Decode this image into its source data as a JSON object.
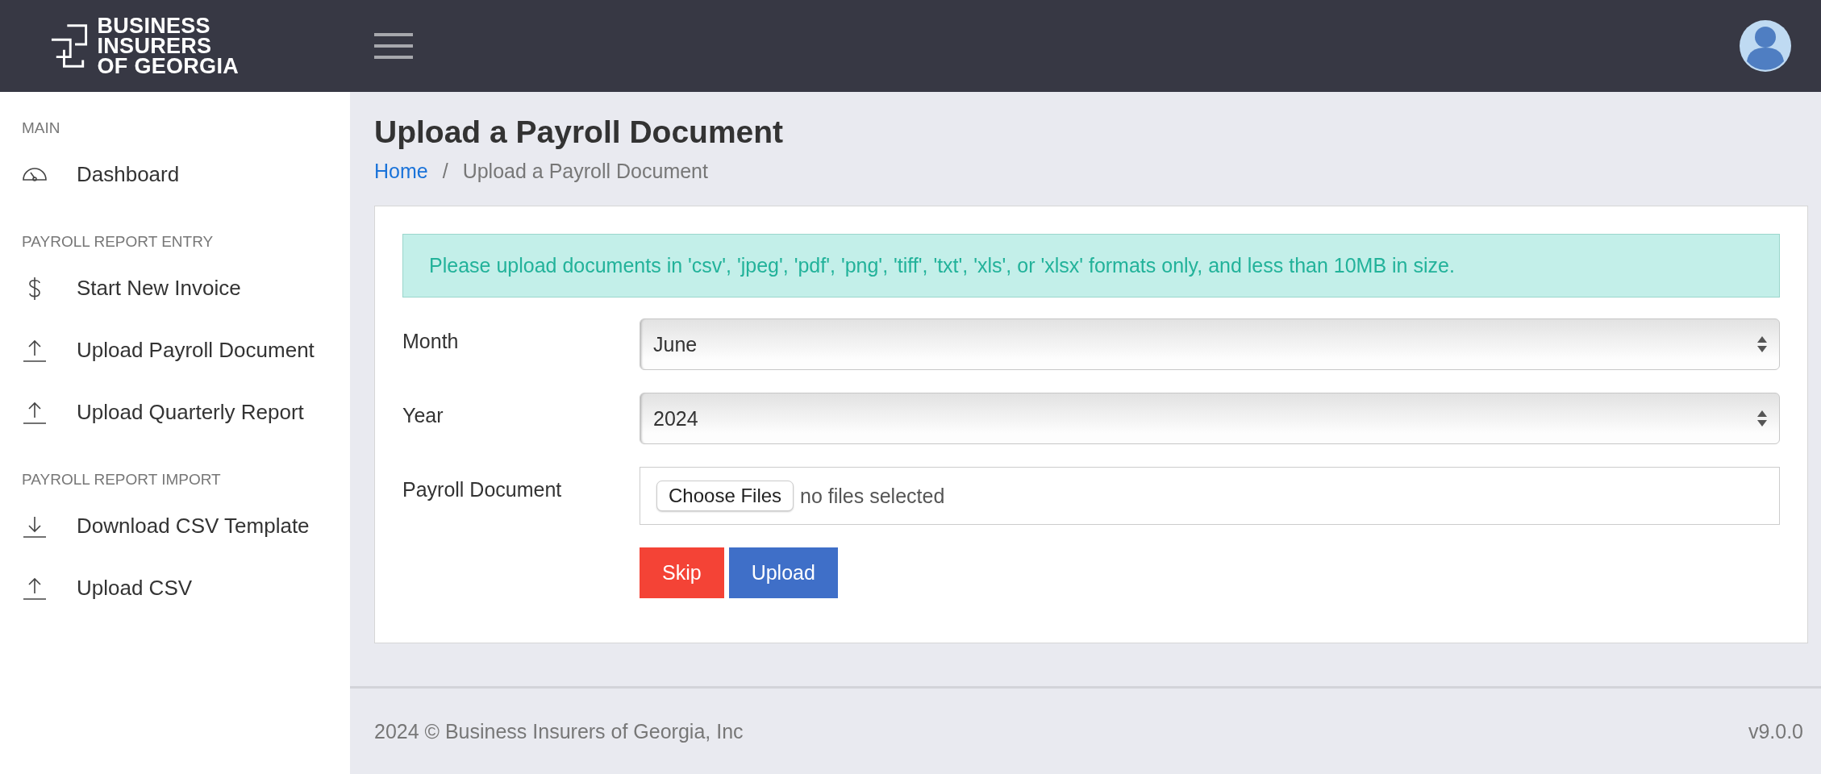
{
  "header": {
    "logo_lines": [
      "BUSINESS INSURERS",
      "OF GEORGIA"
    ]
  },
  "sidebar": {
    "sections": [
      {
        "title": "MAIN",
        "items": [
          {
            "label": "Dashboard",
            "kind": "gauge"
          }
        ]
      },
      {
        "title": "PAYROLL REPORT ENTRY",
        "items": [
          {
            "label": "Start New Invoice",
            "kind": "dollar"
          },
          {
            "label": "Upload Payroll Document",
            "kind": "upload"
          },
          {
            "label": "Upload Quarterly Report",
            "kind": "upload"
          }
        ]
      },
      {
        "title": "PAYROLL REPORT IMPORT",
        "items": [
          {
            "label": "Download CSV Template",
            "kind": "download"
          },
          {
            "label": "Upload CSV",
            "kind": "upload"
          }
        ]
      }
    ]
  },
  "page": {
    "title": "Upload a Payroll Document",
    "breadcrumb": [
      {
        "label": "Home",
        "kind": "link"
      },
      {
        "label": "/",
        "kind": "separator"
      },
      {
        "label": "Upload a Payroll Document",
        "kind": "current"
      }
    ]
  },
  "form": {
    "alert": "Please upload documents in 'csv', 'jpeg', 'pdf', 'png', 'tiff', 'txt', 'xls', or 'xlsx' formats only, and less than 10MB in size.",
    "fields": [
      {
        "label": "Month",
        "kind": "select",
        "value": "June"
      },
      {
        "label": "Year",
        "kind": "select",
        "value": "2024"
      },
      {
        "label": "Payroll Document",
        "kind": "file",
        "button": "Choose Files",
        "value": "no files selected"
      }
    ],
    "buttons": [
      {
        "label": "Skip",
        "kind": "danger"
      },
      {
        "label": "Upload",
        "kind": "primary"
      }
    ]
  },
  "footer": {
    "copyright": "2024 © Business Insurers of Georgia, Inc",
    "version": "v9.0.0"
  }
}
